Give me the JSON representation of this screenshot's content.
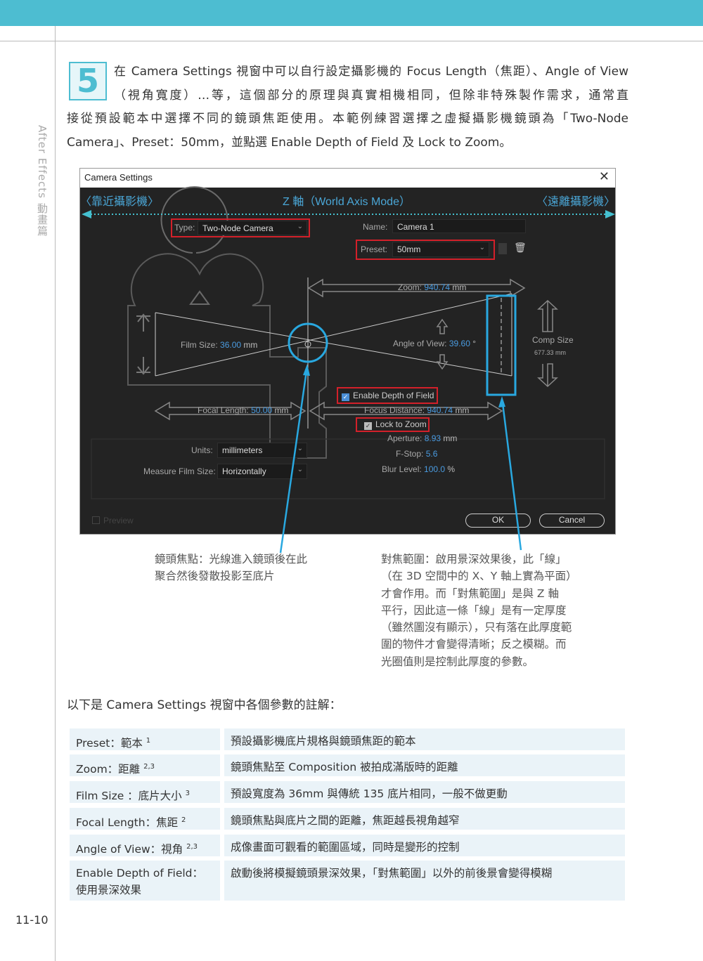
{
  "page": {
    "side_label": "After Effects 動畫篇",
    "page_number": "11-10",
    "step_number": "5",
    "paragraph_lines": [
      "在 Camera Settings 視窗中可以自行設定攝影機的 Focus Length（焦距）、Angle of View",
      "（視角寬度）…等，這個部分的原理與真實相機相同，但除非特殊製作需求，通常直",
      "接從預設範本中選擇不同的鏡頭焦距使用。本範例練習選擇之虛擬攝影機鏡頭為「Two-Node",
      "Camera」、Preset：50mm，並點選 Enable Depth of Field 及 Lock to Zoom。"
    ],
    "accent_color": "#4dbdd1"
  },
  "dialog": {
    "title": "Camera Settings",
    "close_icon": "close-icon",
    "annotations": {
      "near": "〈靠近攝影機〉",
      "axis": "Z 軸（World Axis Mode）",
      "far": "〈遠離攝影機〉"
    },
    "type_label": "Type:",
    "type_value": "Two-Node Camera",
    "name_label": "Name:",
    "name_value": "Camera 1",
    "preset_label": "Preset:",
    "preset_value": "50mm",
    "zoom_label": "Zoom:",
    "zoom_value": "940.74",
    "zoom_unit": "mm",
    "film_size_label": "Film Size:",
    "film_size_value": "36.00",
    "film_size_unit": "mm",
    "angle_label": "Angle of View:",
    "angle_value": "39.60",
    "angle_unit": "°",
    "comp_size_label": "Comp Size",
    "comp_size_value": "677.33 mm",
    "dof_label": "Enable Depth of Field",
    "dof_checked": true,
    "focal_label": "Focal Length:",
    "focal_value": "50.00",
    "focal_unit": "mm",
    "focus_label": "Focus Distance:",
    "focus_value": "940.74",
    "focus_unit": "mm",
    "lock_label": "Lock to Zoom",
    "lock_checked": true,
    "aperture_label": "Aperture:",
    "aperture_value": "8.93",
    "aperture_unit": "mm",
    "fstop_label": "F-Stop:",
    "fstop_value": "5.6",
    "blur_label": "Blur Level:",
    "blur_value": "100.0",
    "blur_unit": "%",
    "units_label": "Units:",
    "units_value": "millimeters",
    "measure_label": "Measure Film Size:",
    "measure_value": "Horizontally",
    "preview_label": "Preview",
    "ok_label": "OK",
    "cancel_label": "Cancel",
    "highlight_color": "#d3202a",
    "annotation_color": "#29a8e0"
  },
  "captions": {
    "left": [
      "鏡頭焦點：光線進入鏡頭後在此",
      "聚合然後發散投影至底片"
    ],
    "right": [
      "對焦範圍：啟用景深效果後，此「線」",
      "（在 3D 空間中的 X、Y 軸上實為平面）",
      "才會作用。而「對焦範圍」是與 Z 軸",
      "平行，因此這一條「線」是有一定厚度",
      "（雖然圖沒有顯示），只有落在此厚度範",
      "圍的物件才會變得清晰；反之模糊。而",
      "光圈值則是控制此厚度的參數。"
    ]
  },
  "intro": "以下是 Camera Settings 視窗中各個參數的註解：",
  "table": [
    {
      "term": "Preset：範本",
      "sup": "1",
      "desc": "預設攝影機底片規格與鏡頭焦距的範本"
    },
    {
      "term": "Zoom：距離",
      "sup": "2,3",
      "desc": "鏡頭焦點至 Composition 被拍成滿版時的距離"
    },
    {
      "term": "Film Size ：底片大小",
      "sup": "3",
      "desc": "預設寬度為 36mm 與傳統 135 底片相同，一般不做更動"
    },
    {
      "term": "Focal Length：焦距",
      "sup": "2",
      "desc": "鏡頭焦點與底片之間的距離，焦距越長視角越窄"
    },
    {
      "term": "Angle of View：視角",
      "sup": "2,3",
      "desc": "成像畫面可觀看的範圍區域，同時是變形的控制"
    },
    {
      "term": "Enable Depth of Field：",
      "term2": "使用景深效果",
      "desc": "啟動後將模擬鏡頭景深效果，「對焦範圍」以外的前後景會變得模糊"
    }
  ]
}
